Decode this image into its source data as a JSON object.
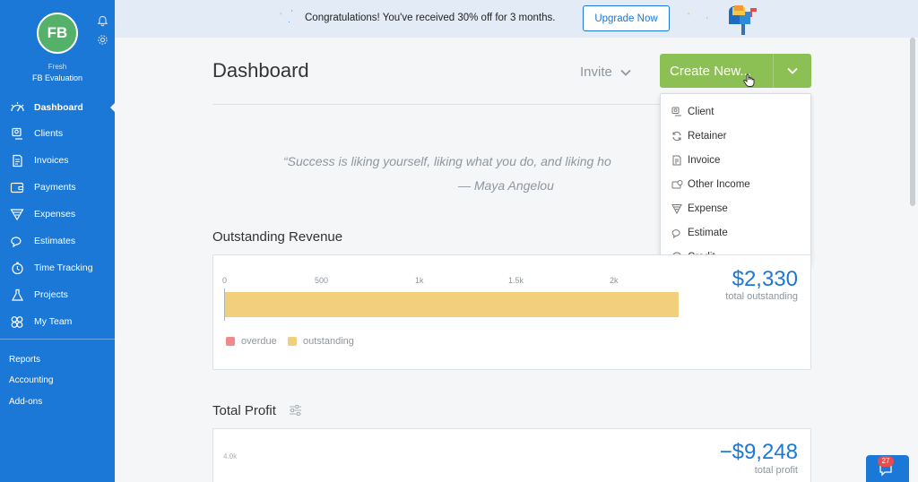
{
  "sidebar": {
    "avatar_initials": "FB",
    "business_name": "Fresh",
    "business_subtitle": "FB Evaluation",
    "nav": [
      {
        "label": "Dashboard",
        "icon": "dashboard-icon",
        "active": true
      },
      {
        "label": "Clients",
        "icon": "clients-icon"
      },
      {
        "label": "Invoices",
        "icon": "invoices-icon"
      },
      {
        "label": "Payments",
        "icon": "payments-icon"
      },
      {
        "label": "Expenses",
        "icon": "expenses-icon"
      },
      {
        "label": "Estimates",
        "icon": "estimates-icon"
      },
      {
        "label": "Time Tracking",
        "icon": "time-tracking-icon"
      },
      {
        "label": "Projects",
        "icon": "projects-icon"
      },
      {
        "label": "My Team",
        "icon": "team-icon"
      }
    ],
    "links": [
      "Reports",
      "Accounting",
      "Add-ons"
    ]
  },
  "banner": {
    "text": "Congratulations! You've received 30% off for 3 months.",
    "button": "Upgrade Now"
  },
  "header": {
    "title": "Dashboard",
    "invite": "Invite",
    "create_new": "Create New..."
  },
  "create_menu": [
    "Client",
    "Retainer",
    "Invoice",
    "Other Income",
    "Expense",
    "Estimate",
    "Credit"
  ],
  "quote": {
    "text": "“Success is liking yourself, liking what you do, and liking ho",
    "author": "— Maya Angelou"
  },
  "outstanding": {
    "title": "Outstanding Revenue",
    "amount": "$2,330",
    "amount_label": "total outstanding",
    "axis_ticks": [
      "0",
      "500",
      "1k",
      "1.5k",
      "2k"
    ],
    "legend": [
      "overdue",
      "outstanding"
    ],
    "value": 2330,
    "axis_max": 2500,
    "colors": {
      "overdue": "#f08a8a",
      "outstanding": "#f1cf7c"
    }
  },
  "profit": {
    "title": "Total Profit",
    "amount": "−$9,248",
    "amount_label": "total profit",
    "first_tick": "4.0k"
  },
  "help": {
    "badge": "27"
  },
  "colors": {
    "brand_blue": "#1b78d6",
    "create_green": "#8cc055",
    "avatar_green": "#55b06a"
  }
}
